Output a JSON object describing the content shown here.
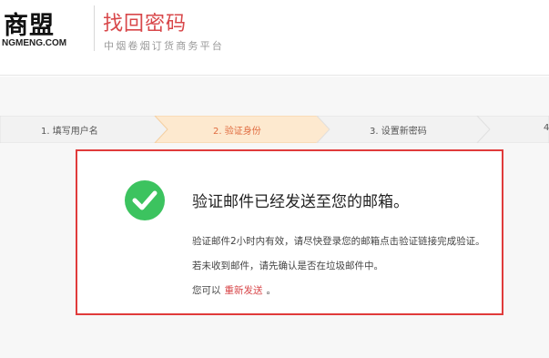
{
  "header": {
    "logo_text": "商盟",
    "logo_domain": "NGMENG.COM",
    "title": "找回密码",
    "subtitle": "中烟卷烟订货商务平台"
  },
  "steps": [
    {
      "label": "1. 填写用户名",
      "state": "done"
    },
    {
      "label": "2. 验证身份",
      "state": "active"
    },
    {
      "label": "3. 设置新密码",
      "state": "pending"
    },
    {
      "label": "4",
      "state": "pending"
    }
  ],
  "message": {
    "title": "验证邮件已经发送至您的邮箱。",
    "line1": "验证邮件2小时内有效，请尽快登录您的邮箱点击验证链接完成验证。",
    "line2": "若未收到邮件，请先确认是否在垃圾邮件中。",
    "line3_prefix": "您可以",
    "resend_label": "重新发送",
    "line3_suffix": "。"
  },
  "colors": {
    "accent": "#d8474a",
    "success": "#3cc35f",
    "box_border": "#e03b3b",
    "active_step_bg": "#fde9cf",
    "active_step_text": "#e06b3f"
  }
}
